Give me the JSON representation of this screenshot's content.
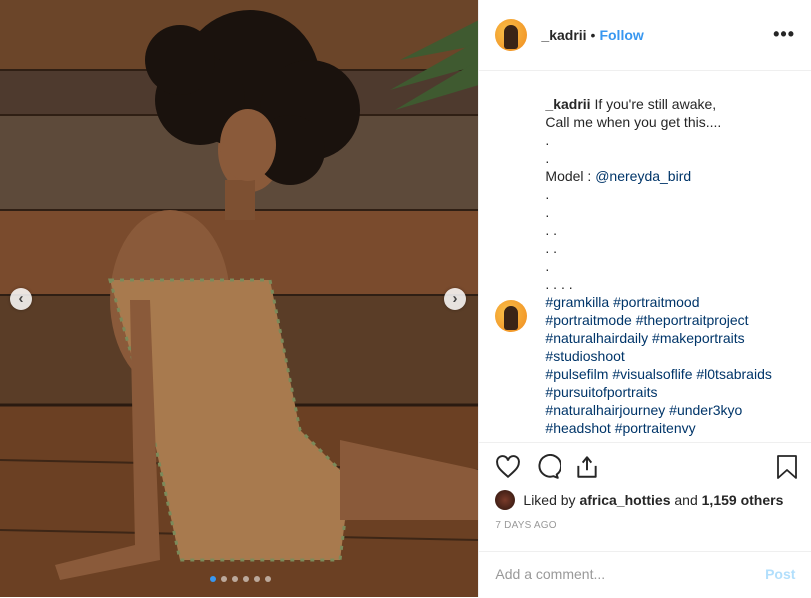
{
  "header": {
    "username": "_kadrii",
    "separator": "•",
    "follow_label": "Follow",
    "more_label": "•••"
  },
  "caption": {
    "username": "_kadrii",
    "lines": [
      "If you're still awake,",
      "Call me when you get this....",
      ".",
      ".",
      "Model : ",
      ".",
      ".",
      ". .",
      ". .",
      ".",
      ". . . ."
    ],
    "mention": "@nereyda_bird",
    "hashtag_lines": [
      [
        "#gramkilla",
        "#portraitmood"
      ],
      [
        "#portraitmode",
        "#theportraitproject"
      ],
      [
        "#naturalhairdaily",
        "#makeportraits"
      ],
      [
        "#studioshoot"
      ],
      [
        "#pulsefilm",
        "#visualsoflife",
        " #l0tsabraids"
      ],
      [
        "#pursuitofportraits"
      ],
      [
        "#naturalhairjourney",
        "#under3kyo"
      ],
      [
        "#headshot",
        "#portraitenvy"
      ]
    ]
  },
  "actions": {
    "icons": [
      "heart-icon",
      "comment-icon",
      "share-icon",
      "bookmark-icon"
    ]
  },
  "likes": {
    "prefix": "Liked by",
    "user": "africa_hotties",
    "middle": "and",
    "count": "1,159 others"
  },
  "timestamp": "7 DAYS AGO",
  "add_comment": {
    "placeholder": "Add a comment...",
    "post_label": "Post"
  },
  "carousel": {
    "left_arrow": "‹",
    "right_arrow": "›",
    "dot_count": 6,
    "active_dot": 0
  },
  "colors": {
    "accent": "#3897f0",
    "link": "#003569",
    "muted": "#999999",
    "border": "#efefef"
  }
}
